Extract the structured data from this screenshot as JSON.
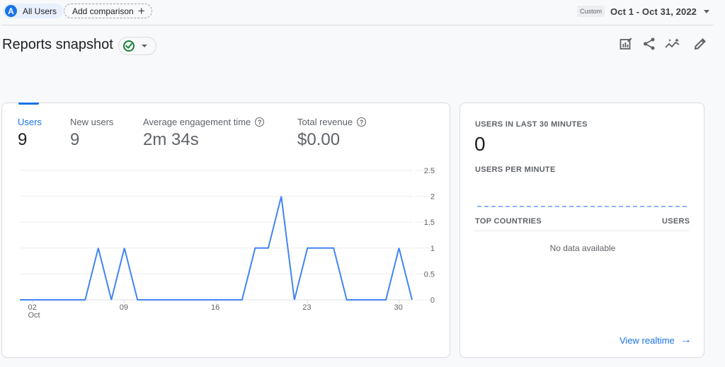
{
  "top_bar": {
    "segment_avatar": "A",
    "segment_label": "All Users",
    "add_comparison_label": "Add comparison",
    "date_preset": "Custom",
    "date_range": "Oct 1 - Oct 31, 2022"
  },
  "header": {
    "title": "Reports snapshot",
    "toolbar_icons": [
      "customize-report-icon",
      "share-icon",
      "insights-icon",
      "edit-icon"
    ]
  },
  "metrics": [
    {
      "label": "Users",
      "value": "9",
      "active": true,
      "help": false
    },
    {
      "label": "New users",
      "value": "9",
      "active": false,
      "help": false
    },
    {
      "label": "Average engagement time",
      "value": "2m 34s",
      "active": false,
      "help": true
    },
    {
      "label": "Total revenue",
      "value": "$0.00",
      "active": false,
      "help": true
    }
  ],
  "chart_data": {
    "type": "line",
    "title": "",
    "xlabel": "",
    "ylabel": "",
    "x": [
      1,
      2,
      3,
      4,
      5,
      6,
      7,
      8,
      9,
      10,
      11,
      12,
      13,
      14,
      15,
      16,
      17,
      18,
      19,
      20,
      21,
      22,
      23,
      24,
      25,
      26,
      27,
      28,
      29,
      30,
      31
    ],
    "x_tick_labels": [
      {
        "day": 2,
        "label": "02",
        "sublabel": "Oct"
      },
      {
        "day": 9,
        "label": "09",
        "sublabel": ""
      },
      {
        "day": 16,
        "label": "16",
        "sublabel": ""
      },
      {
        "day": 23,
        "label": "23",
        "sublabel": ""
      },
      {
        "day": 30,
        "label": "30",
        "sublabel": ""
      }
    ],
    "y_ticks": [
      "0",
      "0.5",
      "1",
      "1.5",
      "2",
      "2.5"
    ],
    "ylim": [
      0,
      2.5
    ],
    "grid": true,
    "series": [
      {
        "name": "Users",
        "color": "#4285f4",
        "values": [
          0,
          0,
          0,
          0,
          0,
          0,
          1,
          0,
          1,
          0,
          0,
          0,
          0,
          0,
          0,
          0,
          0,
          0,
          1,
          1,
          2,
          0,
          1,
          1,
          1,
          0,
          0,
          0,
          0,
          1,
          0
        ]
      }
    ]
  },
  "realtime": {
    "users_30_label": "USERS IN LAST 30 MINUTES",
    "users_30_value": "0",
    "per_minute_label": "USERS PER MINUTE",
    "top_countries_label": "TOP COUNTRIES",
    "users_col_label": "USERS",
    "empty_text": "No data available",
    "view_link": "View realtime"
  }
}
